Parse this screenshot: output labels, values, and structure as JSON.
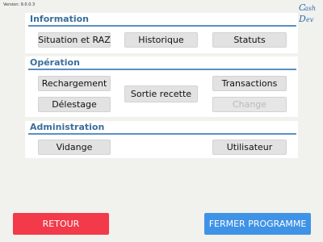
{
  "version_text": "Version: 9.0.0.3",
  "logo": {
    "line1": "ash",
    "line2": "ev",
    "color": "#2f6fb0"
  },
  "sections": {
    "information": {
      "title": "Information",
      "buttons": {
        "situation": "Situation et RAZ",
        "historique": "Historique",
        "statuts": "Statuts"
      }
    },
    "operation": {
      "title": "Opération",
      "buttons": {
        "rechargement": "Rechargement",
        "delestage": "Délestage",
        "sortie": "Sortie recette",
        "transactions": "Transactions",
        "change": "Change"
      }
    },
    "administration": {
      "title": "Administration",
      "buttons": {
        "vidange": "Vidange",
        "utilisateur": "Utilisateur"
      }
    }
  },
  "footer": {
    "retour": "RETOUR",
    "fermer": "FERMER PROGRAMME"
  },
  "colors": {
    "section_title": "#3b6e9a",
    "retour_bg": "#f23a4a",
    "fermer_bg": "#3f93e6"
  }
}
